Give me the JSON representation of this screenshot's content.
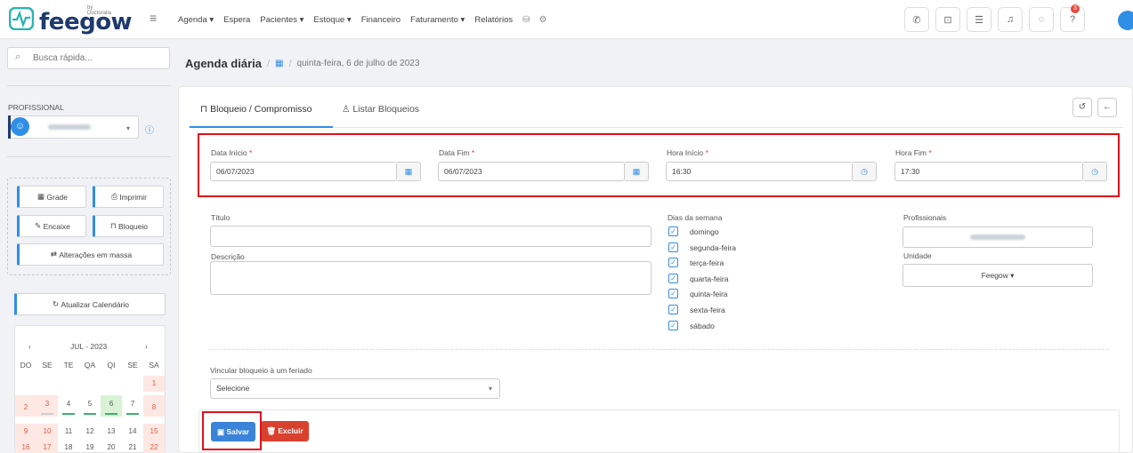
{
  "app": {
    "logo": "feegow",
    "logo_by": "by Doctoralia"
  },
  "topnav": {
    "items": [
      "Agenda ▾",
      "Espera",
      "Pacientes ▾",
      "Estoque ▾",
      "Financeiro",
      "Faturamento ▾",
      "Relatórios"
    ],
    "notif_count": "3"
  },
  "sidebar": {
    "search_placeholder": "Busca rápida...",
    "prof_label": "PROFISSIONAL",
    "buttons": {
      "grade": "Grade",
      "imprimir": "Imprimir",
      "encaixe": "Encaixe",
      "bloqueio": "Bloqueio",
      "alteracoes": "Alterações em massa",
      "atualizar": "Atualizar Calendário"
    },
    "calendar": {
      "month": "JUL - 2023",
      "dow": [
        "DO",
        "SE",
        "TE",
        "QA",
        "QI",
        "SE",
        "SA"
      ],
      "rows": [
        [
          "",
          "",
          "",
          "",
          "",
          "",
          "1"
        ],
        [
          "2",
          "3",
          "4",
          "5",
          "6",
          "7",
          "8"
        ],
        [
          "9",
          "10",
          "11",
          "12",
          "13",
          "14",
          "15"
        ],
        [
          "16",
          "17",
          "18",
          "19",
          "20",
          "21",
          "22"
        ]
      ]
    }
  },
  "breadcrumb": {
    "title": "Agenda diária",
    "date": "quinta-feira, 6 de julho de 2023"
  },
  "tabs": {
    "tab1": "Bloqueio / Compromisso",
    "tab2": "Listar Bloqueios"
  },
  "form": {
    "data_inicio": {
      "label": "Data Início",
      "value": "06/07/2023"
    },
    "data_fim": {
      "label": "Data Fim",
      "value": "06/07/2023"
    },
    "hora_inicio": {
      "label": "Hora Início",
      "value": "16:30"
    },
    "hora_fim": {
      "label": "Hora Fim",
      "value": "17:30"
    },
    "titulo_label": "Título",
    "descricao_label": "Descrição",
    "dias_label": "Dias da semana",
    "dias": [
      "domingo",
      "segunda-feira",
      "terça-feira",
      "quarta-feira",
      "quinta-feira",
      "sexta-feira",
      "sábado"
    ],
    "profissionais_label": "Profissionais",
    "unidade_label": "Unidade",
    "unidade_value": "Feegow ▾",
    "feriado_label": "Vincular bloqueio à um feriado",
    "feriado_value": "Selecione",
    "salvar": "Salvar",
    "excluir": "Excluir"
  },
  "colors": {
    "accent": "#2f8ee6",
    "danger": "#d9412f",
    "highlight": "#e0101a"
  }
}
